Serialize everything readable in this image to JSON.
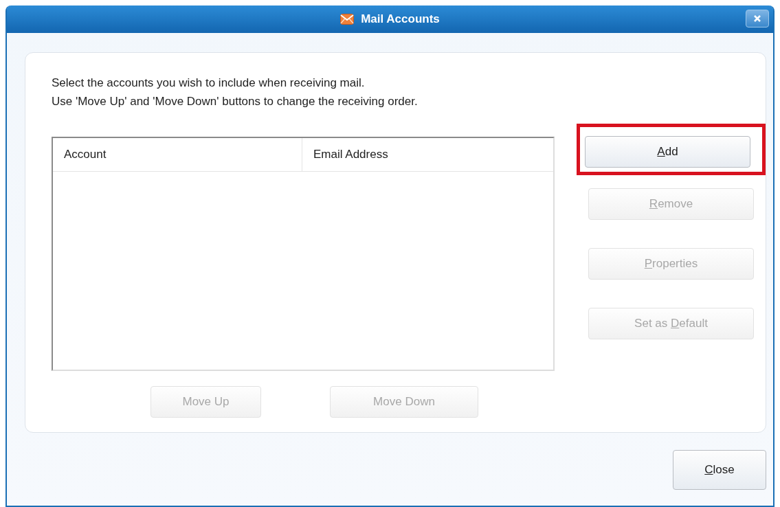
{
  "window": {
    "title": "Mail Accounts"
  },
  "instructions": [
    "Select the accounts you wish to include when receiving mail.",
    "Use 'Move Up' and 'Move Down' buttons to change the receiving order."
  ],
  "table": {
    "columns": [
      "Account",
      "Email Address"
    ]
  },
  "side_buttons": [
    {
      "key": "A",
      "after": "dd",
      "disabled": false,
      "highlighted": true
    },
    {
      "key": "R",
      "after": "emove",
      "disabled": true,
      "highlighted": false
    },
    {
      "key": "P",
      "after": "roperties",
      "disabled": true,
      "highlighted": false
    },
    {
      "before": "Set as ",
      "key": "D",
      "after": "efault",
      "disabled": true,
      "highlighted": false
    }
  ],
  "order_buttons": [
    {
      "label": "Move Up",
      "disabled": true
    },
    {
      "label": "Move Down",
      "disabled": true
    }
  ],
  "close_button": {
    "key": "C",
    "after": "lose",
    "disabled": false
  }
}
